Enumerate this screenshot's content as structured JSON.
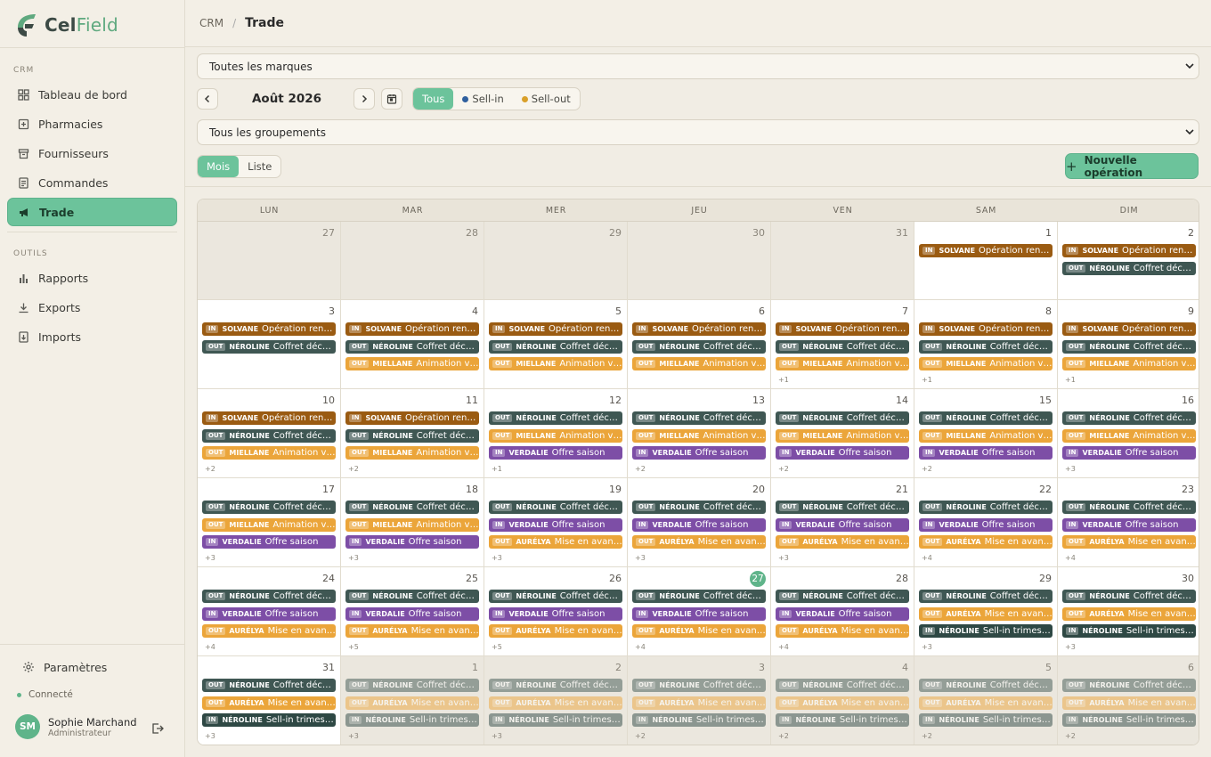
{
  "app": {
    "brand_a": "Cel",
    "brand_b": "Field"
  },
  "sidebar": {
    "section_crm": "CRM",
    "section_tools": "OUTILS",
    "items": [
      {
        "label": "Tableau de bord",
        "icon": "grid-icon"
      },
      {
        "label": "Pharmacies",
        "icon": "pharmacy-icon"
      },
      {
        "label": "Fournisseurs",
        "icon": "box-icon"
      },
      {
        "label": "Commandes",
        "icon": "document-icon"
      },
      {
        "label": "Trade",
        "icon": "megaphone-icon",
        "active": true
      }
    ],
    "tools": [
      {
        "label": "Rapports",
        "icon": "bar-chart-icon"
      },
      {
        "label": "Exports",
        "icon": "download-icon"
      },
      {
        "label": "Imports",
        "icon": "import-icon"
      }
    ],
    "settings": "Paramètres",
    "status": "Connecté",
    "user": {
      "initials": "SM",
      "name": "Sophie Marchand",
      "role": "Administrateur"
    }
  },
  "header": {
    "crumb_root": "CRM",
    "crumb_current": "Trade"
  },
  "filters": {
    "brand_select": "Toutes les marques",
    "group_select": "Tous les groupements",
    "month": "Août 2026",
    "flow": {
      "all": "Tous",
      "sell_in": "Sell-in",
      "sell_out": "Sell-out"
    },
    "view": {
      "month": "Mois",
      "list": "Liste"
    },
    "new_button": "Nouvelle opération"
  },
  "colors": {
    "accent": "#6cc39b",
    "sell_in": "#2f5f9e",
    "sell_out": "#d9a02a"
  },
  "calendar": {
    "weekdays": [
      "LUN",
      "MAR",
      "MER",
      "JEU",
      "VEN",
      "SAM",
      "DIM"
    ],
    "event_types": {
      "SOLVANE": {
        "tag": "IN",
        "text": "Opération rentr…",
        "color": "#9a5b12"
      },
      "NÉROLINE_OUT": {
        "tag": "OUT",
        "text": "Coffret déco…",
        "color": "#3f5753"
      },
      "MIELLANE": {
        "tag": "OUT",
        "text": "Animation vit…",
        "color": "#eba53a"
      },
      "VERDALIE": {
        "tag": "IN",
        "text": "Offre saison",
        "color": "#7d4ea6"
      },
      "AURÉLYA": {
        "tag": "OUT",
        "text": "Mise en avant…",
        "color": "#eba53a"
      },
      "NÉROLINE_IN": {
        "tag": "IN",
        "text": "Sell-in trimestre",
        "color": "#2e4844"
      }
    },
    "weeks": [
      [
        {
          "d": "27",
          "o": 1,
          "e": []
        },
        {
          "d": "28",
          "o": 1,
          "e": []
        },
        {
          "d": "29",
          "o": 1,
          "e": []
        },
        {
          "d": "30",
          "o": 1,
          "e": []
        },
        {
          "d": "31",
          "o": 1,
          "e": []
        },
        {
          "d": "1",
          "e": [
            "SOLVANE"
          ]
        },
        {
          "d": "2",
          "e": [
            "SOLVANE",
            "NÉROLINE_OUT"
          ]
        }
      ],
      [
        {
          "d": "3",
          "e": [
            "SOLVANE",
            "NÉROLINE_OUT"
          ]
        },
        {
          "d": "4",
          "e": [
            "SOLVANE",
            "NÉROLINE_OUT",
            "MIELLANE"
          ]
        },
        {
          "d": "5",
          "e": [
            "SOLVANE",
            "NÉROLINE_OUT",
            "MIELLANE"
          ]
        },
        {
          "d": "6",
          "e": [
            "SOLVANE",
            "NÉROLINE_OUT",
            "MIELLANE"
          ]
        },
        {
          "d": "7",
          "e": [
            "SOLVANE",
            "NÉROLINE_OUT",
            "MIELLANE"
          ],
          "m": "+1"
        },
        {
          "d": "8",
          "e": [
            "SOLVANE",
            "NÉROLINE_OUT",
            "MIELLANE"
          ],
          "m": "+1"
        },
        {
          "d": "9",
          "e": [
            "SOLVANE",
            "NÉROLINE_OUT",
            "MIELLANE"
          ],
          "m": "+1"
        }
      ],
      [
        {
          "d": "10",
          "e": [
            "SOLVANE",
            "NÉROLINE_OUT",
            "MIELLANE"
          ],
          "m": "+2"
        },
        {
          "d": "11",
          "e": [
            "SOLVANE",
            "NÉROLINE_OUT",
            "MIELLANE"
          ],
          "m": "+2"
        },
        {
          "d": "12",
          "e": [
            "NÉROLINE_OUT",
            "MIELLANE",
            "VERDALIE"
          ],
          "m": "+1"
        },
        {
          "d": "13",
          "e": [
            "NÉROLINE_OUT",
            "MIELLANE",
            "VERDALIE"
          ],
          "m": "+2"
        },
        {
          "d": "14",
          "e": [
            "NÉROLINE_OUT",
            "MIELLANE",
            "VERDALIE"
          ],
          "m": "+2"
        },
        {
          "d": "15",
          "e": [
            "NÉROLINE_OUT",
            "MIELLANE",
            "VERDALIE"
          ],
          "m": "+2"
        },
        {
          "d": "16",
          "e": [
            "NÉROLINE_OUT",
            "MIELLANE",
            "VERDALIE"
          ],
          "m": "+3"
        }
      ],
      [
        {
          "d": "17",
          "e": [
            "NÉROLINE_OUT",
            "MIELLANE",
            "VERDALIE"
          ],
          "m": "+3"
        },
        {
          "d": "18",
          "e": [
            "NÉROLINE_OUT",
            "MIELLANE",
            "VERDALIE"
          ],
          "m": "+3"
        },
        {
          "d": "19",
          "e": [
            "NÉROLINE_OUT",
            "VERDALIE",
            "AURÉLYA"
          ],
          "m": "+3"
        },
        {
          "d": "20",
          "e": [
            "NÉROLINE_OUT",
            "VERDALIE",
            "AURÉLYA"
          ],
          "m": "+3"
        },
        {
          "d": "21",
          "e": [
            "NÉROLINE_OUT",
            "VERDALIE",
            "AURÉLYA"
          ],
          "m": "+3"
        },
        {
          "d": "22",
          "e": [
            "NÉROLINE_OUT",
            "VERDALIE",
            "AURÉLYA"
          ],
          "m": "+4"
        },
        {
          "d": "23",
          "e": [
            "NÉROLINE_OUT",
            "VERDALIE",
            "AURÉLYA"
          ],
          "m": "+4"
        }
      ],
      [
        {
          "d": "24",
          "e": [
            "NÉROLINE_OUT",
            "VERDALIE",
            "AURÉLYA"
          ],
          "m": "+4"
        },
        {
          "d": "25",
          "e": [
            "NÉROLINE_OUT",
            "VERDALIE",
            "AURÉLYA"
          ],
          "m": "+5"
        },
        {
          "d": "26",
          "e": [
            "NÉROLINE_OUT",
            "VERDALIE",
            "AURÉLYA"
          ],
          "m": "+5"
        },
        {
          "d": "27",
          "t": 1,
          "e": [
            "NÉROLINE_OUT",
            "VERDALIE",
            "AURÉLYA"
          ],
          "m": "+4"
        },
        {
          "d": "28",
          "e": [
            "NÉROLINE_OUT",
            "VERDALIE",
            "AURÉLYA"
          ],
          "m": "+4"
        },
        {
          "d": "29",
          "e": [
            "NÉROLINE_OUT",
            "AURÉLYA",
            "NÉROLINE_IN"
          ],
          "m": "+3"
        },
        {
          "d": "30",
          "e": [
            "NÉROLINE_OUT",
            "AURÉLYA",
            "NÉROLINE_IN"
          ],
          "m": "+3"
        }
      ],
      [
        {
          "d": "31",
          "e": [
            "NÉROLINE_OUT",
            "AURÉLYA",
            "NÉROLINE_IN"
          ],
          "m": "+3"
        },
        {
          "d": "1",
          "o": 1,
          "e": [
            "NÉROLINE_OUT",
            "AURÉLYA",
            "NÉROLINE_IN"
          ],
          "m": "+3"
        },
        {
          "d": "2",
          "o": 1,
          "e": [
            "NÉROLINE_OUT",
            "AURÉLYA",
            "NÉROLINE_IN"
          ],
          "m": "+3"
        },
        {
          "d": "3",
          "o": 1,
          "e": [
            "NÉROLINE_OUT",
            "AURÉLYA",
            "NÉROLINE_IN"
          ],
          "m": "+2"
        },
        {
          "d": "4",
          "o": 1,
          "e": [
            "NÉROLINE_OUT",
            "AURÉLYA",
            "NÉROLINE_IN"
          ],
          "m": "+2"
        },
        {
          "d": "5",
          "o": 1,
          "e": [
            "NÉROLINE_OUT",
            "AURÉLYA",
            "NÉROLINE_IN"
          ],
          "m": "+2"
        },
        {
          "d": "6",
          "o": 1,
          "e": [
            "NÉROLINE_OUT",
            "AURÉLYA",
            "NÉROLINE_IN"
          ],
          "m": "+2"
        }
      ]
    ]
  }
}
